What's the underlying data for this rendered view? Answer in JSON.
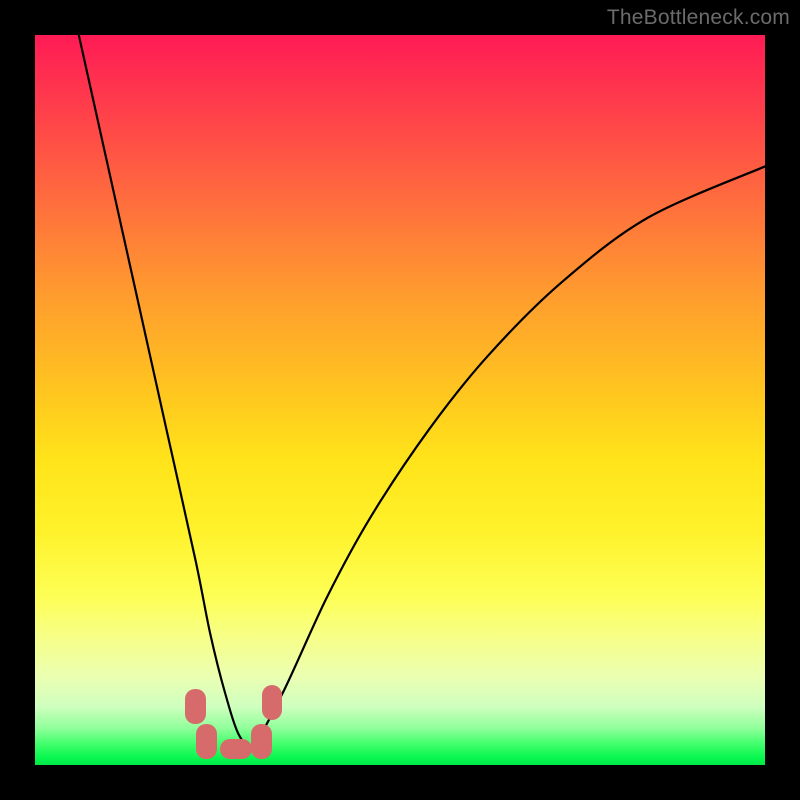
{
  "watermark": "TheBottleneck.com",
  "colors": {
    "frame_bg": "#000000",
    "marker": "#d76b6b",
    "curve": "#000000"
  },
  "chart_data": {
    "type": "line",
    "title": "",
    "xlabel": "",
    "ylabel": "",
    "xlim": [
      0,
      100
    ],
    "ylim": [
      0,
      100
    ],
    "grid": false,
    "series": [
      {
        "name": "bottleneck-curve",
        "x": [
          6,
          10,
          14,
          18,
          22,
          24,
          26,
          28,
          30,
          34,
          40,
          46,
          54,
          62,
          72,
          84,
          100
        ],
        "y": [
          100,
          82,
          64,
          46,
          28,
          18,
          10,
          4,
          3,
          10,
          23,
          34,
          46,
          56,
          66,
          75,
          82
        ]
      }
    ],
    "markers": [
      {
        "shape": "pill",
        "cx": 22.0,
        "cy": 8.0,
        "rx": 1.4,
        "ry": 2.4
      },
      {
        "shape": "pill",
        "cx": 23.5,
        "cy": 3.2,
        "rx": 1.4,
        "ry": 2.4
      },
      {
        "shape": "pill",
        "cx": 27.5,
        "cy": 2.2,
        "rx": 2.2,
        "ry": 1.4
      },
      {
        "shape": "pill",
        "cx": 31.0,
        "cy": 3.2,
        "rx": 1.4,
        "ry": 2.4
      },
      {
        "shape": "pill",
        "cx": 32.5,
        "cy": 8.5,
        "rx": 1.4,
        "ry": 2.4
      }
    ]
  }
}
